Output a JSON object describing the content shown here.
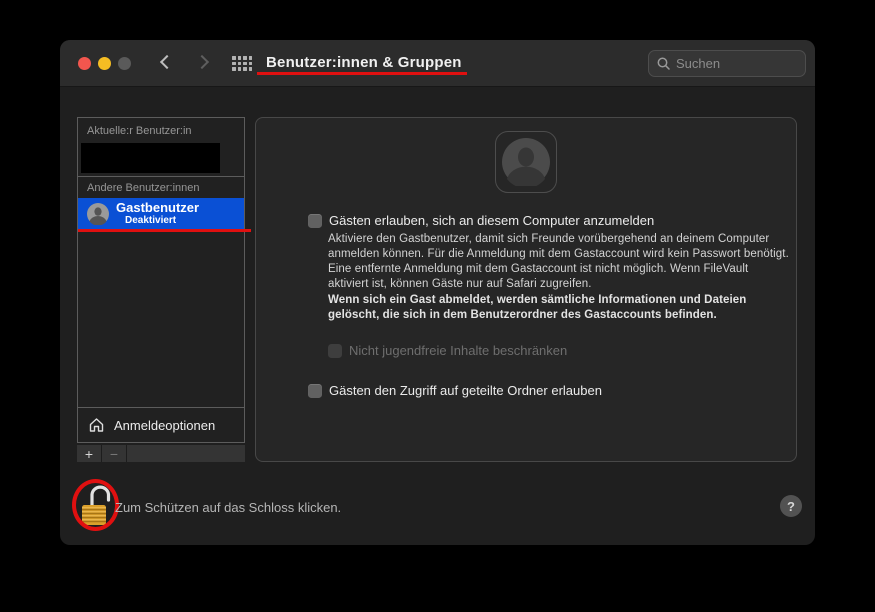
{
  "window": {
    "title": "Benutzer:innen & Gruppen",
    "search_placeholder": "Suchen"
  },
  "sidebar": {
    "current_user_header": "Aktuelle:r Benutzer:in",
    "other_users_header": "Andere Benutzer:innen",
    "guest_user": {
      "name": "Gastbenutzer",
      "status": "Deaktiviert"
    },
    "login_options_label": "Anmeldeoptionen",
    "add_label": "+",
    "remove_label": "−"
  },
  "main": {
    "guest_checkbox_label": "Gästen erlauben, sich an diesem Computer anzumelden",
    "guest_description": "Aktiviere den Gastbenutzer, damit sich Freunde vorübergehend an deinem Computer anmelden können. Für die Anmeldung mit dem Gastaccount wird kein Passwort benötigt. Eine entfernte Anmeldung mit dem Gastaccount ist nicht möglich. Wenn FileVault aktiviert ist, können Gäste nur auf Safari zugreifen.",
    "guest_warning_bold": "Wenn sich ein Gast abmeldet, werden sämtliche Informationen und Dateien gelöscht, die sich in dem Benutzerordner des Gastaccounts befinden.",
    "restrict_checkbox_label": "Nicht jugendfreie Inhalte beschränken",
    "shared_folders_checkbox_label": "Gästen den Zugriff auf geteilte Ordner erlauben"
  },
  "footer": {
    "lock_text": "Zum Schützen auf das Schloss klicken.",
    "help_label": "?"
  },
  "colors": {
    "selection_blue": "#0a50d5",
    "annotation_red": "#e01010",
    "lock_gold": "#dba02b",
    "titlebar": "#2c2c2c",
    "panel_bg": "#262626"
  }
}
